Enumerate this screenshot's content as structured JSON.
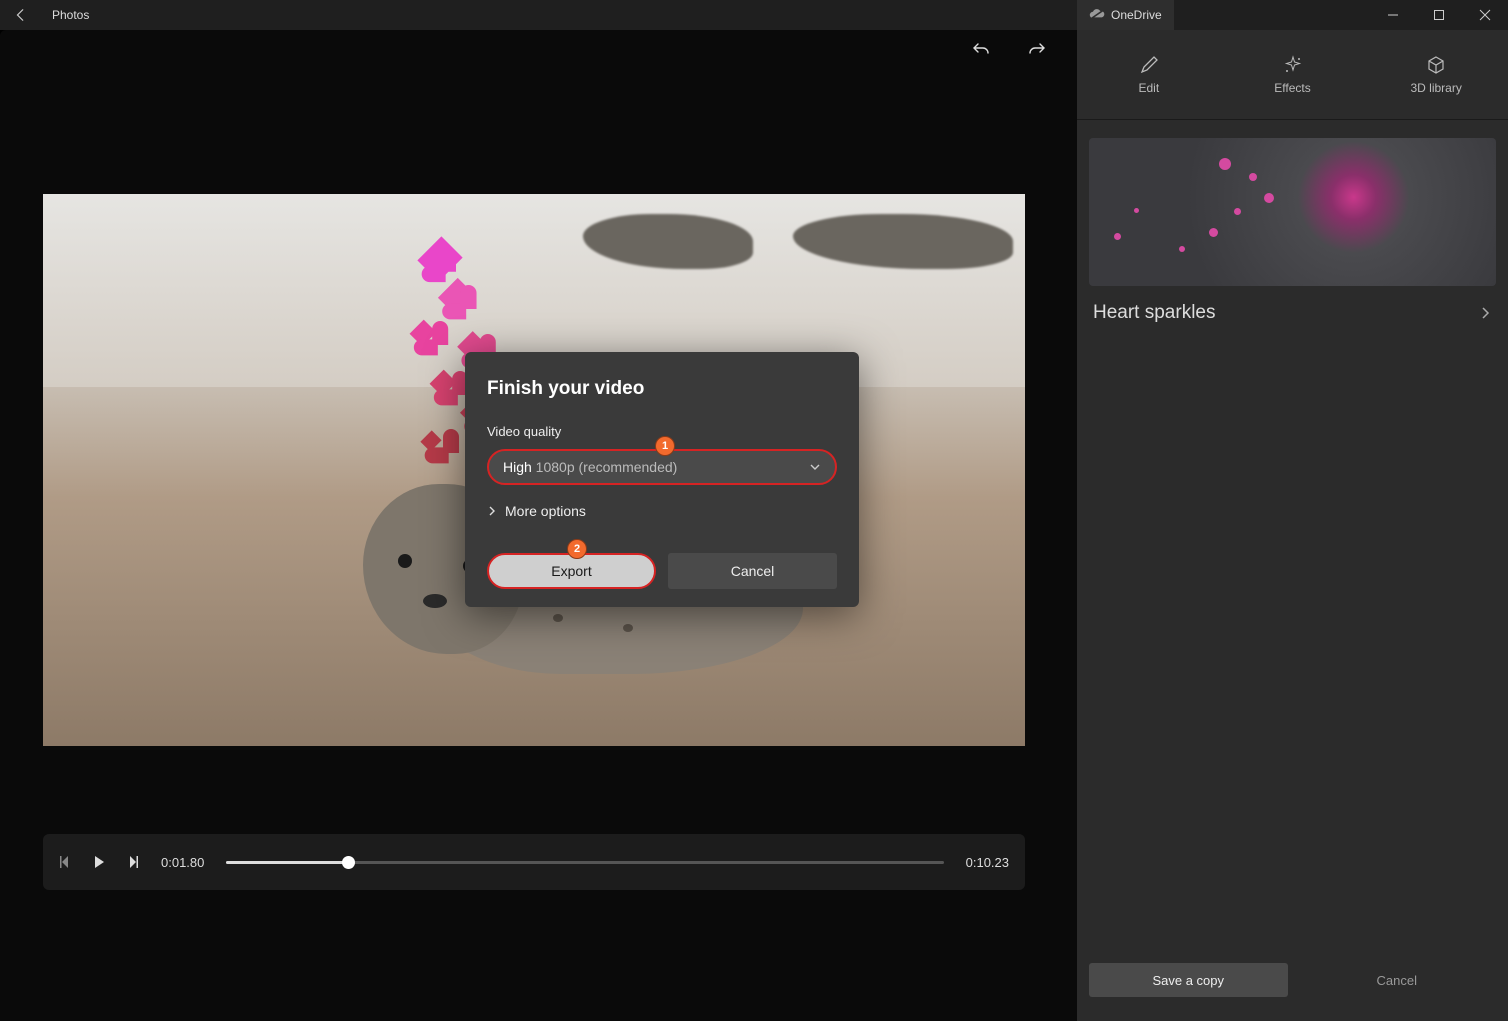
{
  "titlebar": {
    "app_name": "Photos",
    "onedrive_label": "OneDrive"
  },
  "dialog": {
    "title": "Finish your video",
    "quality_label": "Video quality",
    "quality_value_main": "High",
    "quality_value_sub": " 1080p (recommended)",
    "more_options": "More options",
    "export": "Export",
    "cancel": "Cancel",
    "badge1": "1",
    "badge2": "2"
  },
  "playback": {
    "current": "0:01.80",
    "total": "0:10.23",
    "progress_pct": 17
  },
  "right": {
    "tabs": {
      "edit": "Edit",
      "effects": "Effects",
      "lib3d": "3D library"
    },
    "effect_name": "Heart sparkles",
    "save": "Save a copy",
    "cancel": "Cancel"
  }
}
